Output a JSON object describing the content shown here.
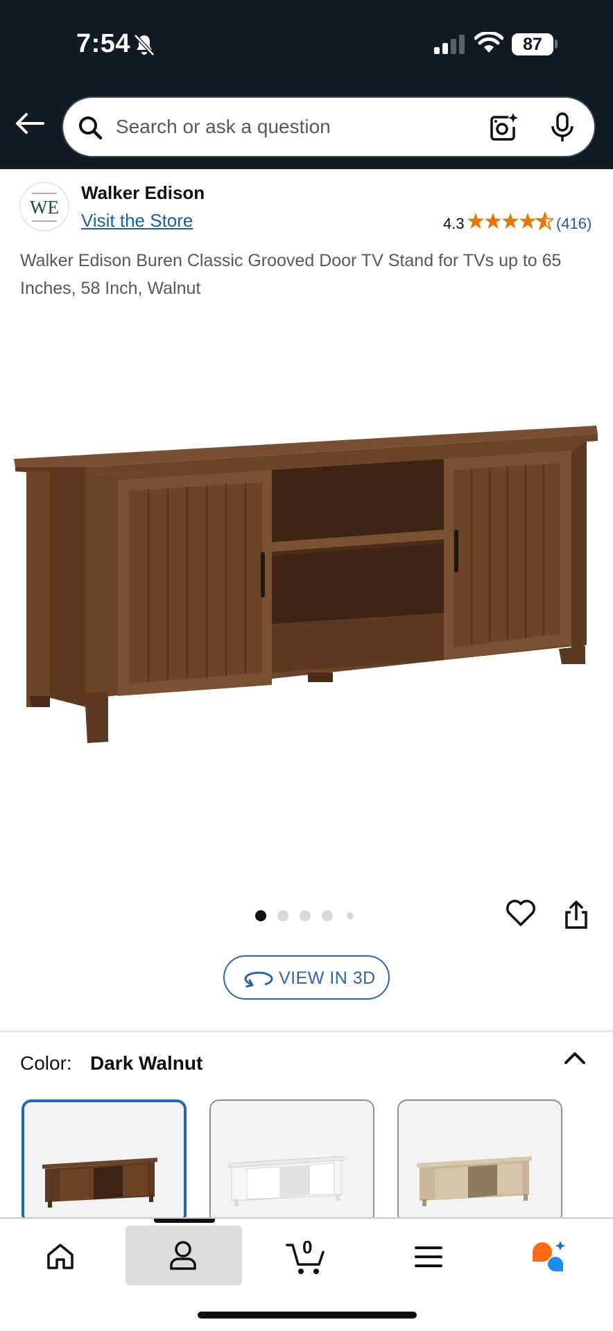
{
  "status_bar": {
    "time": "7:54",
    "battery": "87",
    "icons": [
      "bell-slash-icon",
      "signal-icon",
      "wifi-icon",
      "battery-icon"
    ]
  },
  "search": {
    "placeholder": "Search or ask a question",
    "icons": [
      "back-arrow-icon",
      "search-icon",
      "camera-lens-icon",
      "microphone-icon"
    ]
  },
  "brand": {
    "logo_text": "WE",
    "name": "Walker Edison",
    "store_link": "Visit the Store"
  },
  "rating": {
    "value": "4.3",
    "stars": 4.3,
    "review_count": "(416)"
  },
  "product": {
    "title": "Walker Edison Buren Classic Grooved Door TV Stand for TVs up to 65 Inches, 58 Inch, Walnut",
    "image_count": 5,
    "active_image": 1
  },
  "actions": {
    "view_3d": "VIEW IN 3D"
  },
  "color": {
    "label": "Color:",
    "selected": "Dark Walnut",
    "swatches": [
      "dark-walnut",
      "white",
      "light-oak"
    ]
  },
  "bottom_nav": {
    "cart_count": "0",
    "items": [
      "home-icon",
      "account-icon",
      "cart-icon",
      "menu-icon",
      "rufus-ai-icon"
    ],
    "active": "account-icon"
  },
  "colors": {
    "header_bg": "#131a24",
    "link": "#1a5ea8",
    "star": "#e77600",
    "selected_border": "#2567b4"
  }
}
